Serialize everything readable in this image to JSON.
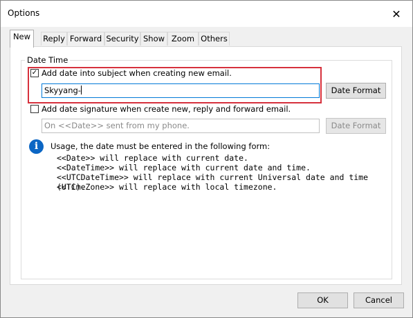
{
  "window": {
    "title": "Options"
  },
  "tabs": [
    {
      "label": "New"
    },
    {
      "label": "Reply"
    },
    {
      "label": "Forward"
    },
    {
      "label": "Security"
    },
    {
      "label": "Show"
    },
    {
      "label": "Zoom"
    },
    {
      "label": "Others"
    }
  ],
  "group": {
    "label": "Date Time"
  },
  "subject_option": {
    "label": "Add date into subject when creating new email.",
    "checked": true,
    "value": "Skyyang-",
    "format_button": "Date Format"
  },
  "signature_option": {
    "label": "Add date signature when create new, reply and forward email.",
    "checked": false,
    "placeholder": "On <<Date>> sent from my phone.",
    "format_button": "Date Format"
  },
  "usage": {
    "heading": "Usage, the date must be entered in the following form:",
    "lines": [
      "<<Date>> will replace with current date.",
      "<<DateTime>> will replace with current date and time.",
      "<<UTCDateTime>> will replace with current Universal date and time (UTC).",
      "<<TimeZone>> will replace with local timezone."
    ]
  },
  "footer": {
    "ok": "OK",
    "cancel": "Cancel"
  },
  "icons": {
    "close": "close-icon",
    "info": "info-icon",
    "check": "checkmark-icon"
  }
}
